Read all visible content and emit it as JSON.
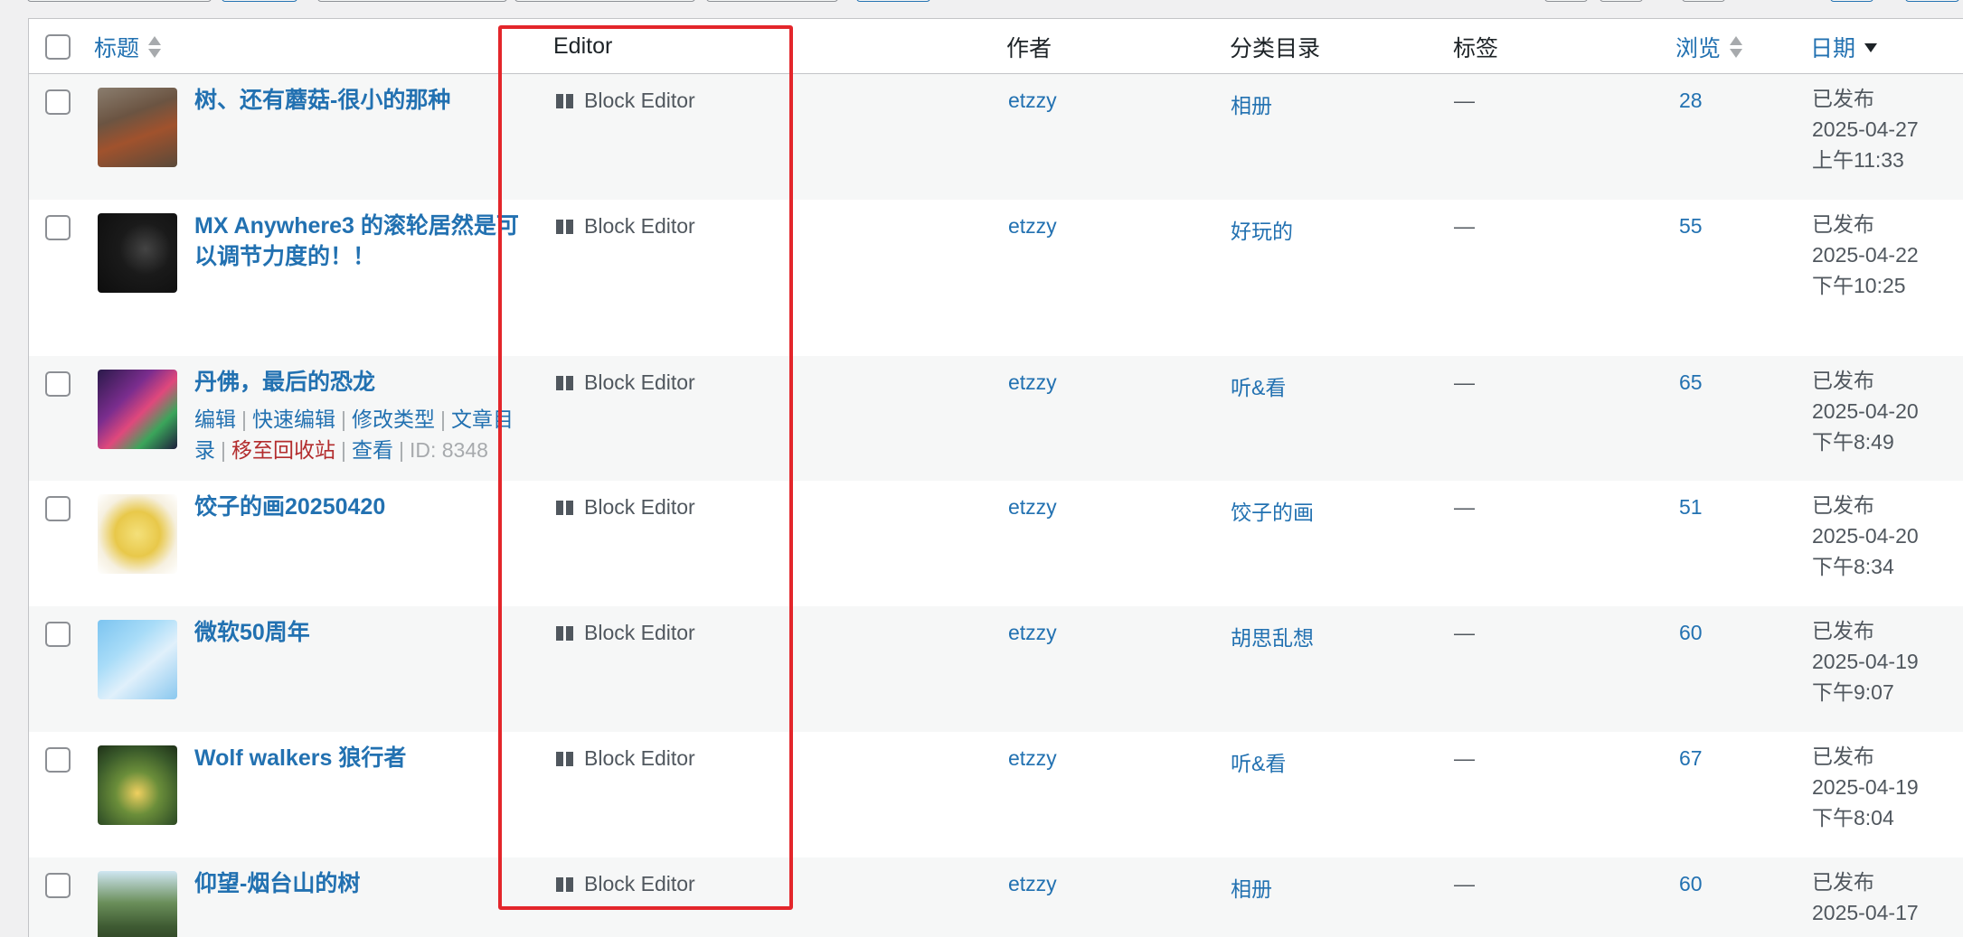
{
  "table": {
    "headers": {
      "title": "标题",
      "editor": "Editor",
      "author": "作者",
      "category": "分类目录",
      "tags": "标签",
      "views": "浏览",
      "date": "日期"
    },
    "rows": [
      {
        "title": "树、还有蘑菇-很小的那种",
        "editor": "Block Editor",
        "author": "etzzy",
        "category": "相册",
        "tags": "—",
        "views": "28",
        "status": "已发布",
        "date": "2025-04-27",
        "time": "上午11:33"
      },
      {
        "title": "MX Anywhere3 的滚轮居然是可以调节力度的！！",
        "editor": "Block Editor",
        "author": "etzzy",
        "category": "好玩的",
        "tags": "—",
        "views": "55",
        "status": "已发布",
        "date": "2025-04-22",
        "time": "下午10:25"
      },
      {
        "title": "丹佛，最后的恐龙",
        "editor": "Block Editor",
        "author": "etzzy",
        "category": "听&看",
        "tags": "—",
        "views": "65",
        "status": "已发布",
        "date": "2025-04-20",
        "time": "下午8:49",
        "actions": {
          "edit": "编辑",
          "quick_edit": "快速编辑",
          "change_type": "修改类型",
          "toc": "文章目录",
          "trash": "移至回收站",
          "view": "查看",
          "id": "ID: 8348"
        }
      },
      {
        "title": "饺子的画20250420",
        "editor": "Block Editor",
        "author": "etzzy",
        "category": "饺子的画",
        "tags": "—",
        "views": "51",
        "status": "已发布",
        "date": "2025-04-20",
        "time": "下午8:34"
      },
      {
        "title": "微软50周年",
        "editor": "Block Editor",
        "author": "etzzy",
        "category": "胡思乱想",
        "tags": "—",
        "views": "60",
        "status": "已发布",
        "date": "2025-04-19",
        "time": "下午9:07"
      },
      {
        "title": "Wolf walkers 狼行者",
        "editor": "Block Editor",
        "author": "etzzy",
        "category": "听&看",
        "tags": "—",
        "views": "67",
        "status": "已发布",
        "date": "2025-04-19",
        "time": "下午8:04"
      },
      {
        "title": "仰望-烟台山的树",
        "editor": "Block Editor",
        "author": "etzzy",
        "category": "相册",
        "tags": "—",
        "views": "60",
        "status": "已发布",
        "date": "2025-04-17",
        "time": ""
      }
    ]
  },
  "colors": {
    "link": "#2271b1",
    "trash": "#b32d2e",
    "highlight": "#e3262b"
  }
}
